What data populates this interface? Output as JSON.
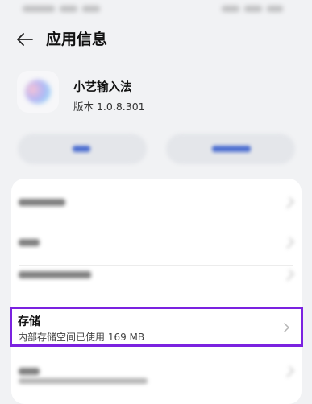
{
  "header": {
    "title": "应用信息"
  },
  "app": {
    "name": "小艺输入法",
    "version": "版本 1.0.8.301"
  },
  "actions": {
    "left_label": "",
    "right_label": ""
  },
  "rows": [
    {
      "label": ""
    },
    {
      "label": ""
    },
    {
      "label": ""
    }
  ],
  "storage": {
    "title": "存储",
    "subtitle": "内部存储空间已使用 169 MB"
  },
  "colors": {
    "highlight": "#7b22e0",
    "background": "#f1f2f4",
    "card": "#ffffff"
  },
  "icons": {
    "back": "arrow-left-icon",
    "storage_chevron": "chevron-right-icon"
  }
}
